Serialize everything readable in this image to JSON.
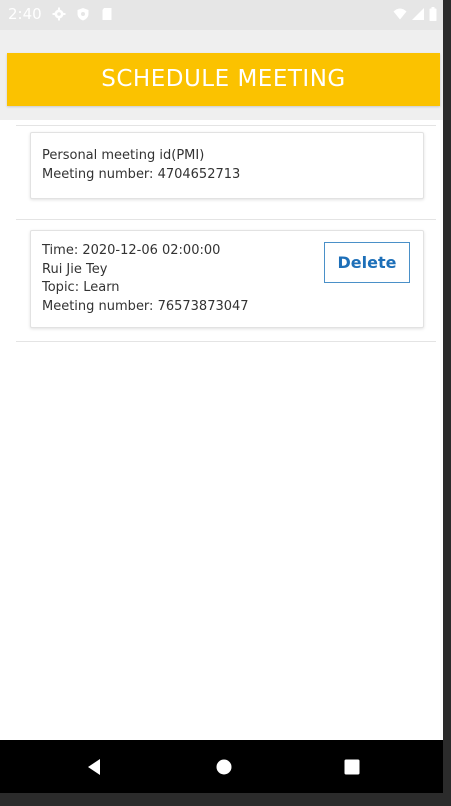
{
  "status_bar": {
    "time": "2:40",
    "left_icons": [
      "gear-icon",
      "shield-icon",
      "sd-card-icon"
    ],
    "right_icons": [
      "wifi-icon",
      "signal-icon",
      "battery-icon"
    ]
  },
  "header": {
    "schedule_button_label": "SCHEDULE MEETING"
  },
  "colors": {
    "accent": "#fbc200",
    "delete_text": "#1d6fb8",
    "delete_border": "#4a90c8"
  },
  "pmi_card": {
    "title": "Personal meeting id(PMI)",
    "meeting_number": "Meeting number: 4704652713"
  },
  "meetings": [
    {
      "time": "Time: 2020-12-06 02:00:00",
      "host": "Rui Jie Tey",
      "topic": "Topic: Learn",
      "meeting_number": "Meeting number: 76573873047",
      "delete_label": "Delete"
    }
  ],
  "nav_bar": {
    "buttons": [
      "back-icon",
      "home-icon",
      "recents-icon"
    ]
  }
}
